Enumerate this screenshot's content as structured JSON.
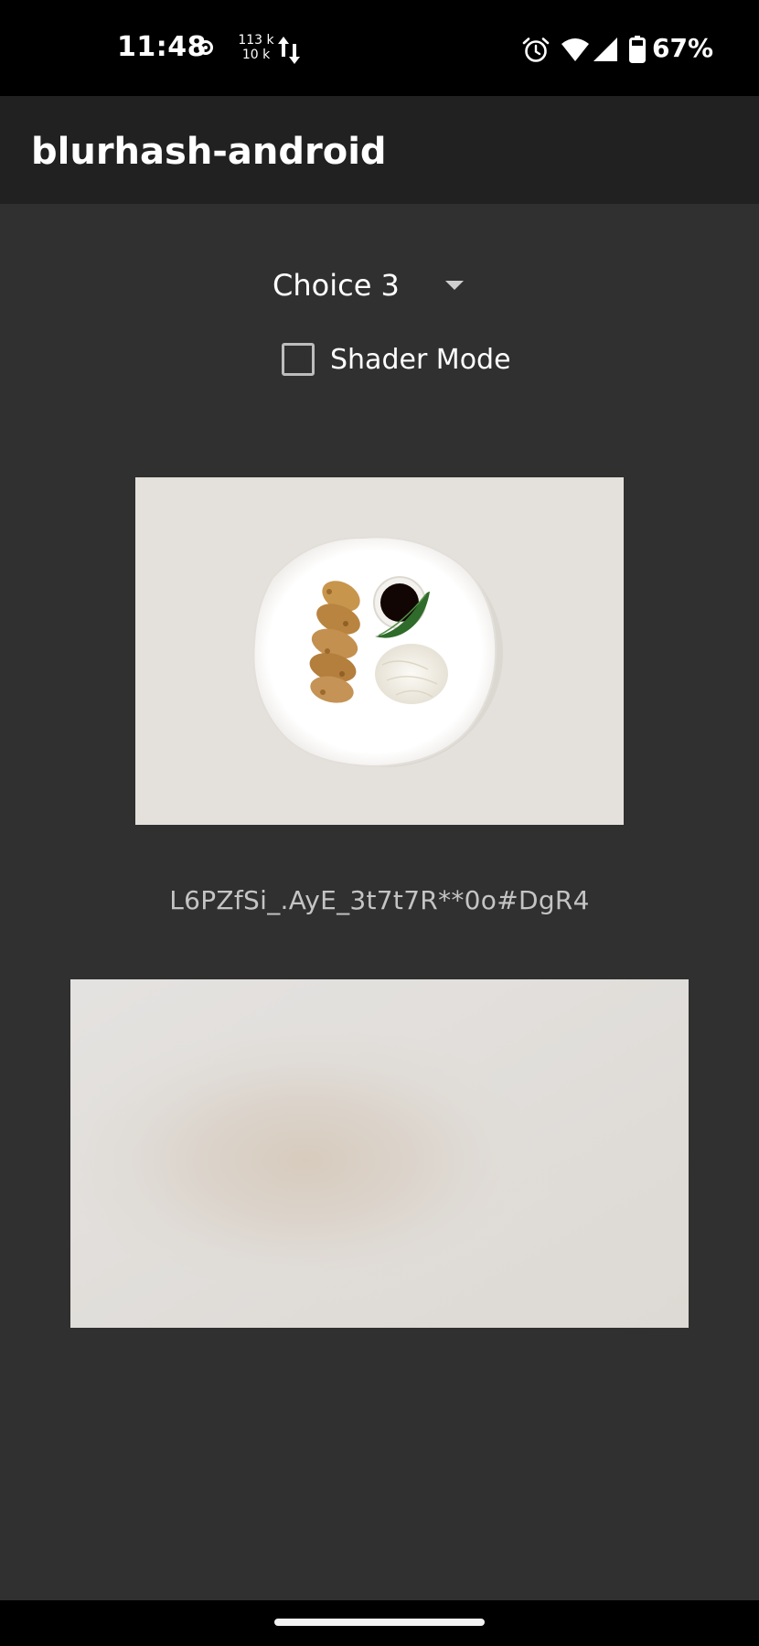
{
  "status_bar": {
    "time": "11:48",
    "net_speed_up": "113 k",
    "net_speed_down": "10 k",
    "battery": "67%",
    "icons": [
      "record-icon",
      "data-transfer-icon",
      "alarm-icon",
      "wifi-icon",
      "cell-signal-icon",
      "battery-icon"
    ]
  },
  "app_bar": {
    "title": "blurhash-android"
  },
  "controls": {
    "spinner_value": "Choice 3",
    "checkbox_label": "Shader Mode",
    "checkbox_checked": false
  },
  "content": {
    "blurhash": "L6PZfSi_.AyE_3t7t7R**0o#DgR4"
  },
  "colors": {
    "background": "#303030",
    "app_bar": "#212121",
    "status_bar": "#000000",
    "text_primary": "#ffffff",
    "text_secondary": "#c4c4c4"
  }
}
